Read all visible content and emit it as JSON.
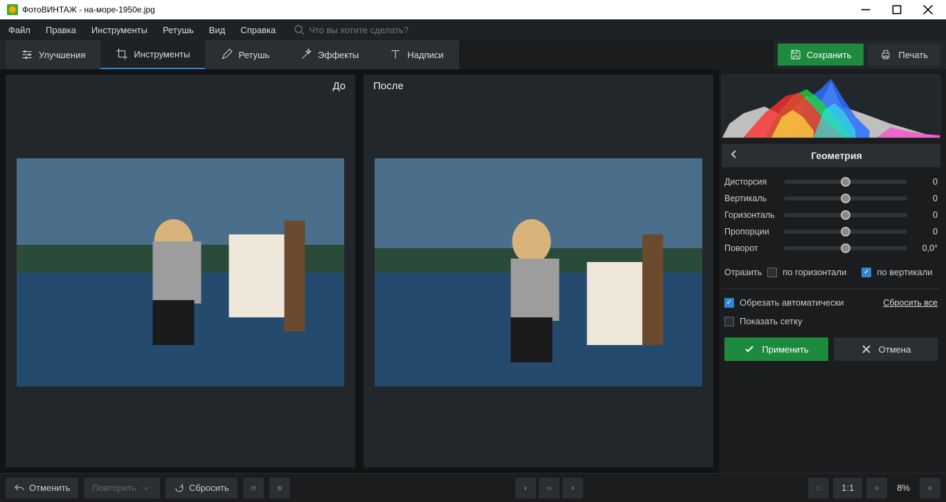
{
  "window": {
    "title": "ФотоВИНТАЖ - на-море-1950е.jpg"
  },
  "menu": {
    "items": [
      "Файл",
      "Правка",
      "Инструменты",
      "Ретушь",
      "Вид",
      "Справка"
    ],
    "search_placeholder": "Что вы хотите сделать?"
  },
  "tooltabs": {
    "items": [
      {
        "label": "Улучшения",
        "active": false
      },
      {
        "label": "Инструменты",
        "active": true
      },
      {
        "label": "Ретушь",
        "active": false
      },
      {
        "label": "Эффекты",
        "active": false
      },
      {
        "label": "Надписи",
        "active": false
      }
    ],
    "save": "Сохранить",
    "print": "Печать"
  },
  "viewer": {
    "before_label": "До",
    "after_label": "После"
  },
  "panel": {
    "title": "Геометрия",
    "sliders": [
      {
        "label": "Дисторсия",
        "value": "0"
      },
      {
        "label": "Вертикаль",
        "value": "0"
      },
      {
        "label": "Горизонталь",
        "value": "0"
      },
      {
        "label": "Пропорции",
        "value": "0"
      },
      {
        "label": "Поворот",
        "value": "0,0°"
      }
    ],
    "flip_label": "Отразить",
    "flip_h": "по горизонтали",
    "flip_v": "по вертикали",
    "flip_h_checked": false,
    "flip_v_checked": true,
    "auto_crop": "Обрезать автоматически",
    "auto_crop_checked": true,
    "show_grid": "Показать сетку",
    "show_grid_checked": false,
    "reset_all": "Сбросить все",
    "apply": "Применить",
    "cancel": "Отмена"
  },
  "bottom": {
    "undo": "Отменить",
    "redo": "Повторить",
    "reset": "Сбросить",
    "zoom_fit": "1:1",
    "zoom_pct": "8%"
  }
}
